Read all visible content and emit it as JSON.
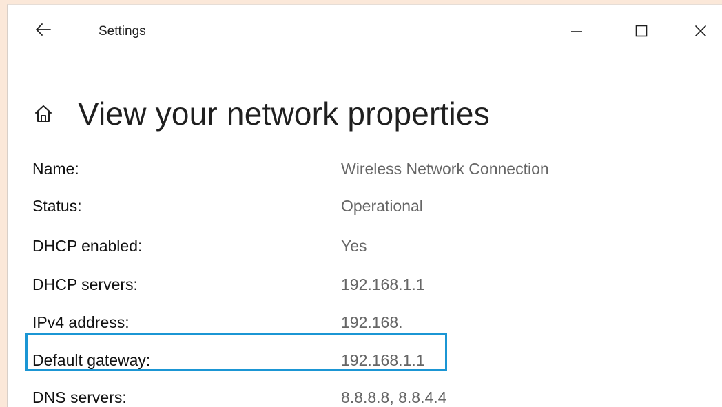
{
  "window": {
    "app_title": "Settings",
    "back_icon": "back-arrow-icon",
    "minimize_icon": "minimize-icon",
    "maximize_icon": "maximize-icon",
    "close_icon": "close-icon"
  },
  "page": {
    "home_icon": "home-icon",
    "title": "View your network properties"
  },
  "properties": [
    {
      "label": "Name:",
      "value": "Wireless Network Connection"
    },
    {
      "label": "Status:",
      "value": "Operational"
    },
    {
      "label": "DHCP enabled:",
      "value": "Yes"
    },
    {
      "label": "DHCP servers:",
      "value": "192.168.1.1"
    },
    {
      "label": "IPv4 address:",
      "value": "192.168."
    },
    {
      "label": "Default gateway:",
      "value": "192.168.1.1"
    },
    {
      "label": "DNS servers:",
      "value": "8.8.8.8, 8.8.4.4"
    }
  ],
  "highlight": {
    "row": "Default gateway:",
    "color": "#1b96d4"
  },
  "colors": {
    "background": "#fbe8d9",
    "label_text": "#111111",
    "value_text": "#666666"
  }
}
